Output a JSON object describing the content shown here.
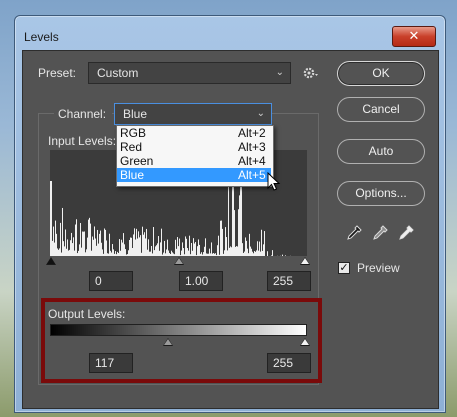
{
  "window": {
    "title": "Levels",
    "close_label": "✕"
  },
  "preset": {
    "label": "Preset:",
    "value": "Custom",
    "gear_icon": "gear-icon"
  },
  "channel": {
    "label": "Channel:",
    "value": "Blue"
  },
  "input_levels": {
    "label": "Input Levels:",
    "black": "0",
    "gamma": "1.00",
    "white": "255"
  },
  "output_levels": {
    "label": "Output Levels:",
    "black": "117",
    "white": "255"
  },
  "buttons": {
    "ok": "OK",
    "cancel": "Cancel",
    "auto": "Auto",
    "options": "Options..."
  },
  "preview": {
    "label": "Preview",
    "checked": true,
    "check_glyph": "✓"
  },
  "channel_menu": [
    {
      "name": "RGB",
      "shortcut": "Alt+2"
    },
    {
      "name": "Red",
      "shortcut": "Alt+3"
    },
    {
      "name": "Green",
      "shortcut": "Alt+4"
    },
    {
      "name": "Blue",
      "shortcut": "Alt+5"
    }
  ],
  "colors": {
    "selection": "#3399ff",
    "highlight_box": "#7a0a0a",
    "panel": "#535353"
  }
}
